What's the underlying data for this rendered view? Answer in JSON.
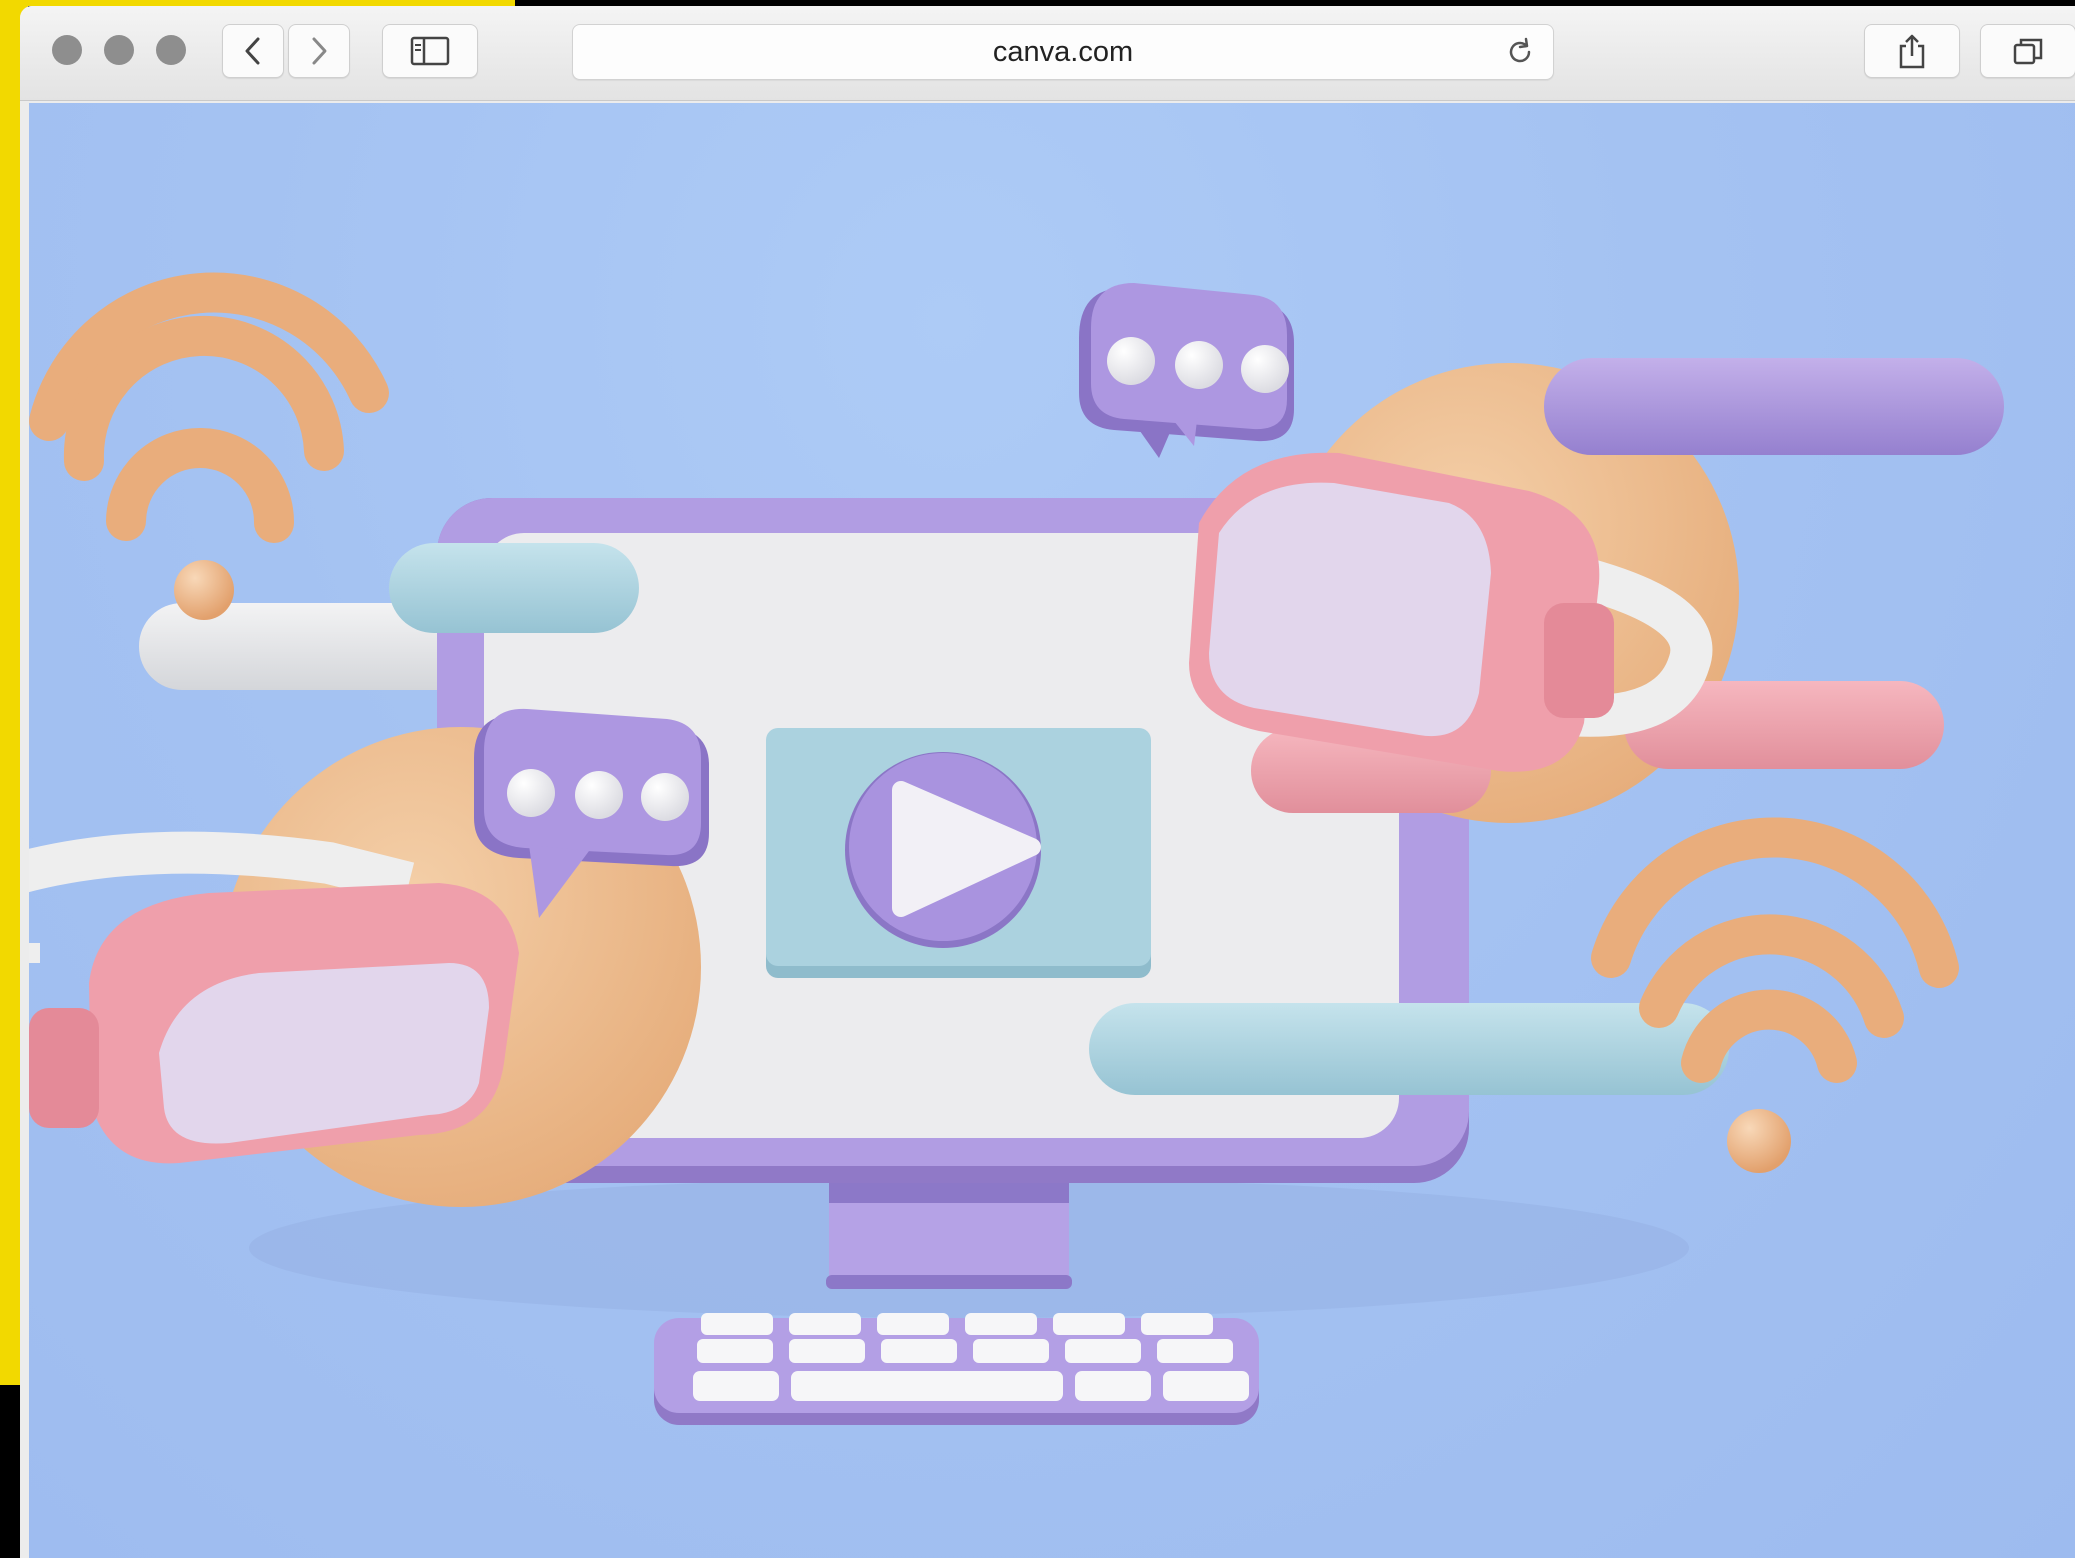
{
  "browser": {
    "url": "canva.com",
    "icons": {
      "back": "chevron-left-icon",
      "forward": "chevron-right-icon",
      "sidebar": "sidebar-icon",
      "reload": "reload-icon",
      "share": "share-icon",
      "tabs": "tabs-icon"
    },
    "traffic_light_color": "#8e8e8e"
  },
  "illustration": {
    "background_color": "#a4c2f2",
    "palette": {
      "purple": "#a38bd6",
      "peach": "#efbf8f",
      "pink": "#ee9faa",
      "teal": "#a9d2df",
      "white": "#f1f1f3"
    },
    "elements": [
      "computer-monitor",
      "video-player",
      "play-icon",
      "keyboard",
      "chat-bubble",
      "chat-bubble",
      "vr-headset",
      "vr-headset",
      "wifi-icon",
      "wifi-icon"
    ]
  }
}
